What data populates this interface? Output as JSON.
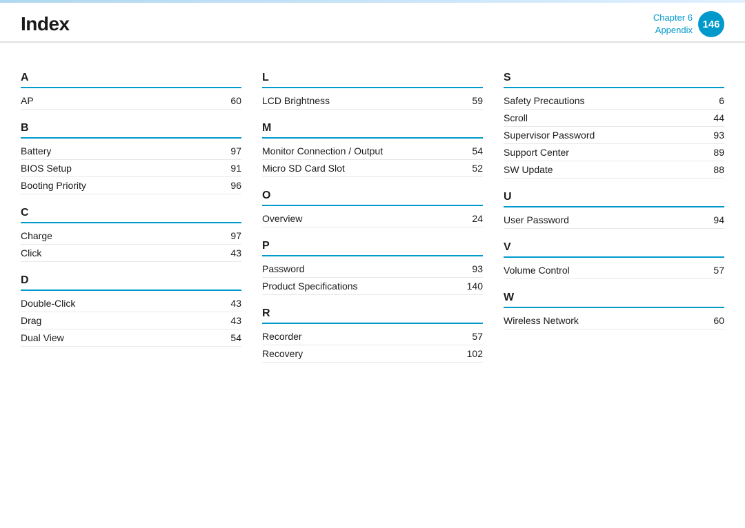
{
  "header": {
    "title": "Index",
    "chapter_label": "Chapter 6",
    "appendix_label": "Appendix",
    "page_number": "146"
  },
  "columns": [
    {
      "sections": [
        {
          "letter": "A",
          "entries": [
            {
              "term": "AP",
              "page": "60"
            }
          ]
        },
        {
          "letter": "B",
          "entries": [
            {
              "term": "Battery",
              "page": "97"
            },
            {
              "term": "BIOS Setup",
              "page": "91"
            },
            {
              "term": "Booting Priority",
              "page": "96"
            }
          ]
        },
        {
          "letter": "C",
          "entries": [
            {
              "term": "Charge",
              "page": "97"
            },
            {
              "term": "Click",
              "page": "43"
            }
          ]
        },
        {
          "letter": "D",
          "entries": [
            {
              "term": "Double-Click",
              "page": "43"
            },
            {
              "term": "Drag",
              "page": "43"
            },
            {
              "term": "Dual View",
              "page": "54"
            }
          ]
        }
      ]
    },
    {
      "sections": [
        {
          "letter": "L",
          "entries": [
            {
              "term": "LCD Brightness",
              "page": "59"
            }
          ]
        },
        {
          "letter": "M",
          "entries": [
            {
              "term": "Monitor Connection / Output",
              "page": "54"
            },
            {
              "term": "Micro SD Card Slot",
              "page": "52"
            }
          ]
        },
        {
          "letter": "O",
          "entries": [
            {
              "term": "Overview",
              "page": "24"
            }
          ]
        },
        {
          "letter": "P",
          "entries": [
            {
              "term": "Password",
              "page": "93"
            },
            {
              "term": "Product Specifications",
              "page": "140"
            }
          ]
        },
        {
          "letter": "R",
          "entries": [
            {
              "term": "Recorder",
              "page": "57"
            },
            {
              "term": "Recovery",
              "page": "102"
            }
          ]
        }
      ]
    },
    {
      "sections": [
        {
          "letter": "S",
          "entries": [
            {
              "term": "Safety Precautions",
              "page": "6"
            },
            {
              "term": "Scroll",
              "page": "44"
            },
            {
              "term": "Supervisor Password",
              "page": "93"
            },
            {
              "term": "Support Center",
              "page": "89"
            },
            {
              "term": "SW Update",
              "page": "88"
            }
          ]
        },
        {
          "letter": "U",
          "entries": [
            {
              "term": "User Password",
              "page": "94"
            }
          ]
        },
        {
          "letter": "V",
          "entries": [
            {
              "term": "Volume Control",
              "page": "57"
            }
          ]
        },
        {
          "letter": "W",
          "entries": [
            {
              "term": "Wireless Network",
              "page": "60"
            }
          ]
        }
      ]
    }
  ]
}
